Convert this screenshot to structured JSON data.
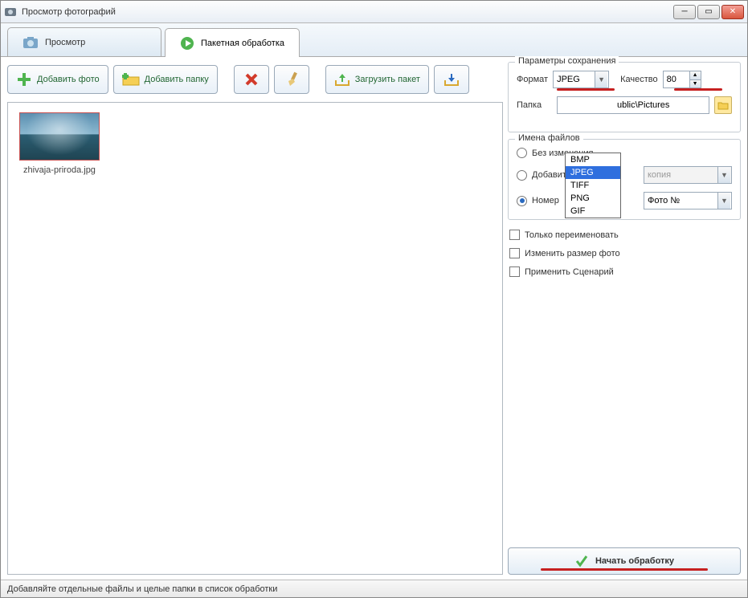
{
  "window": {
    "title": "Просмотр фотографий"
  },
  "tabs": {
    "view": "Просмотр",
    "batch": "Пакетная обработка"
  },
  "toolbar": {
    "add_photo": "Добавить фото",
    "add_folder": "Добавить папку",
    "delete_icon": "delete-icon",
    "clear_icon": "brush-icon",
    "load_batch": "Загрузить пакет",
    "save_icon": "save-batch-icon"
  },
  "files": [
    {
      "name": "zhivaja-priroda.jpg"
    }
  ],
  "save_params": {
    "legend": "Параметры сохранения",
    "format_label": "Формат",
    "format_value": "JPEG",
    "format_options": [
      "BMP",
      "JPEG",
      "TIFF",
      "PNG",
      "GIF"
    ],
    "quality_label": "Качество",
    "quality_value": "80",
    "folder_label": "Папка",
    "folder_value": "ublic\\Pictures"
  },
  "filenames": {
    "legend": "Имена файлов",
    "opt_nochange": "Без изменения",
    "opt_add": "Добавить",
    "add_value": "копия",
    "opt_number": "Номер",
    "number_value": "Фото №"
  },
  "checks": {
    "rename_only": "Только переименовать",
    "resize": "Изменить размер фото",
    "scenario": "Применить Сценарий"
  },
  "start_button": "Начать обработку",
  "statusbar": "Добавляйте отдельные файлы и целые папки в список обработки"
}
